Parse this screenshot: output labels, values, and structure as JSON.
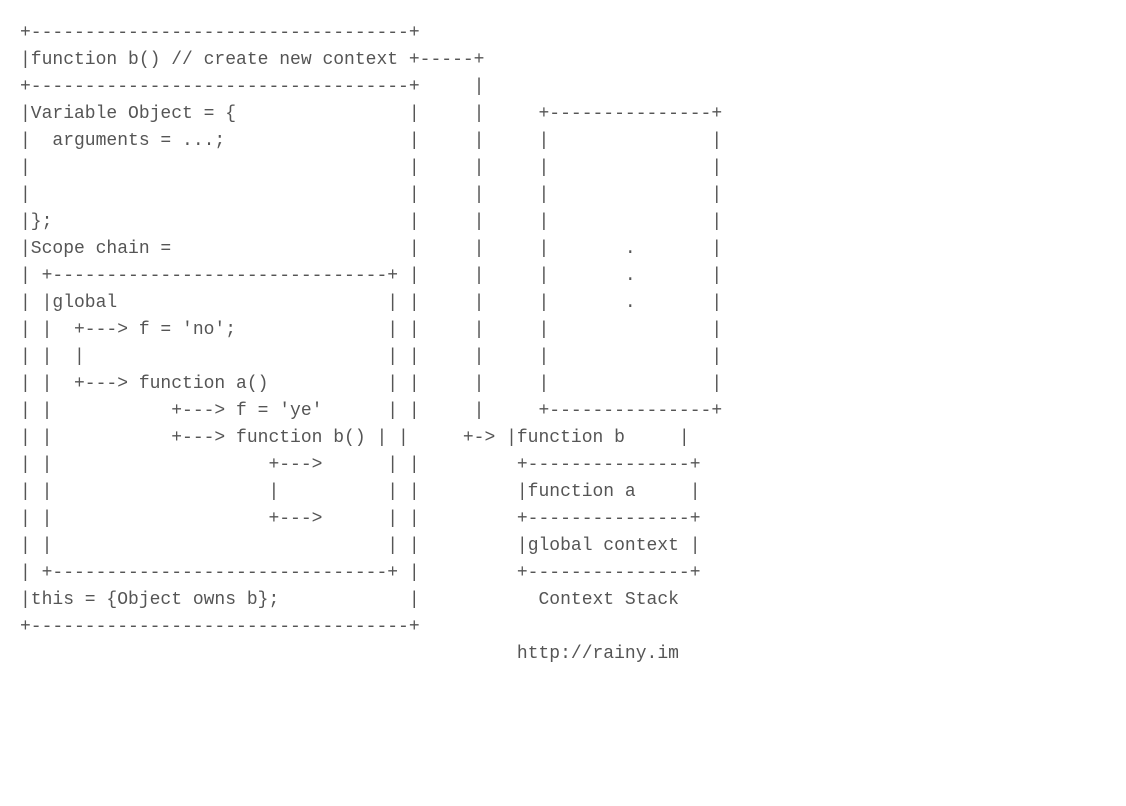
{
  "diagram": {
    "title_line": "|function b() // create new context +-----+",
    "var_obj_open": "|Variable Object = {                |     |",
    "var_obj_arguments": "|  arguments = ...;                 |     |",
    "var_obj_close": "|};                                 |     |",
    "scope_chain_label": "|Scope chain =                      |     |",
    "scope_global": "| |global                         | |     |",
    "scope_f_no": "| |  +---> f = 'no';              | |     |",
    "scope_func_a": "| |  +---> function a()           | |     |",
    "scope_f_ye": "| |           +---> f = 'ye'      | |     |",
    "scope_func_b": "| |           +---> function b() | |     +-> |function b     |",
    "scope_inner_arrow1": "| |                    +--->      | |         +---------------+",
    "scope_inner_pipe": "| |                    |          | |         |function a     |",
    "scope_inner_arrow2": "| |                    +--->      | |         +---------------+",
    "this_line": "|this = {Object owns b};            |",
    "stack_top": "function b",
    "stack_mid": "function a",
    "stack_bottom": "global context",
    "stack_label": "Context Stack",
    "url": "http://rainy.im"
  }
}
